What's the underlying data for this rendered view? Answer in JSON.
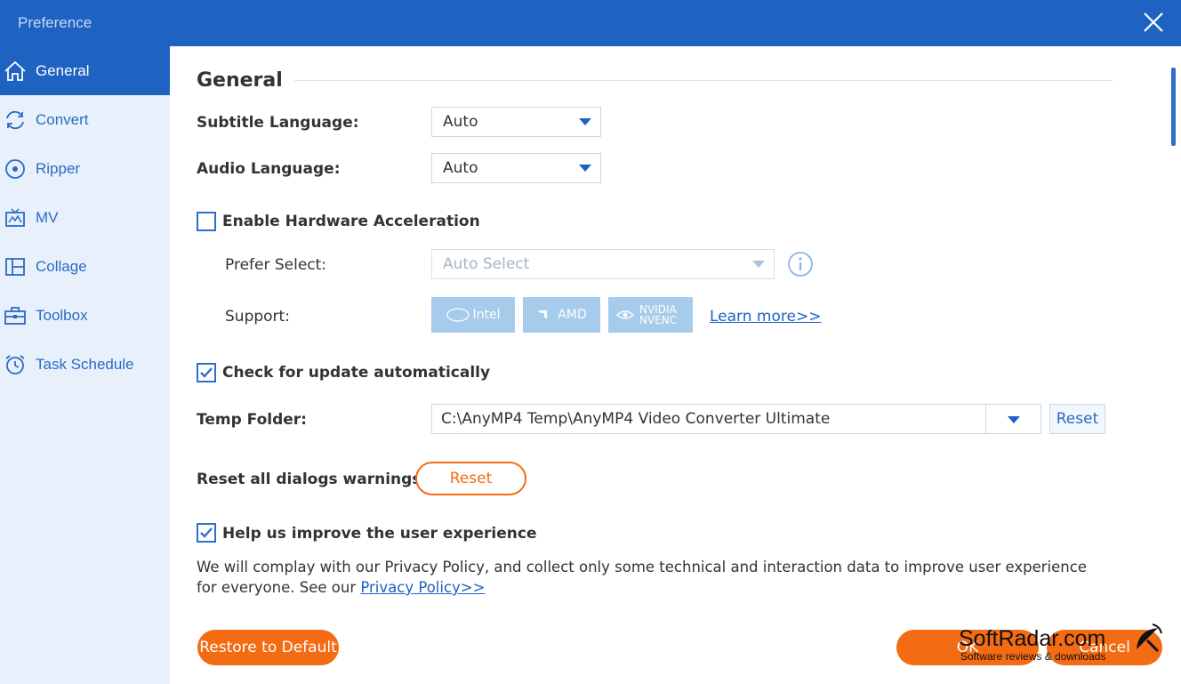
{
  "window": {
    "title": "Preference",
    "close_icon": "close-icon"
  },
  "sidebar": {
    "items": [
      {
        "label": "General",
        "icon": "home-icon",
        "active": true
      },
      {
        "label": "Convert",
        "icon": "convert-icon",
        "active": false
      },
      {
        "label": "Ripper",
        "icon": "disc-icon",
        "active": false
      },
      {
        "label": "MV",
        "icon": "tv-icon",
        "active": false
      },
      {
        "label": "Collage",
        "icon": "collage-icon",
        "active": false
      },
      {
        "label": "Toolbox",
        "icon": "toolbox-icon",
        "active": false
      },
      {
        "label": "Task Schedule",
        "icon": "alarm-clock-icon",
        "active": false
      }
    ]
  },
  "general": {
    "section_title": "General",
    "subtitle_language": {
      "label": "Subtitle Language:",
      "value": "Auto"
    },
    "audio_language": {
      "label": "Audio Language:",
      "value": "Auto"
    },
    "hardware_acceleration": {
      "label": "Enable Hardware Acceleration",
      "checked": false
    },
    "prefer_select": {
      "label": "Prefer Select:",
      "value": "Auto Select"
    },
    "support": {
      "label": "Support:",
      "badges": [
        "Intel",
        "AMD",
        "NVIDIA NVENC"
      ],
      "learn_more": "Learn more>>"
    },
    "check_update": {
      "label": "Check for update automatically",
      "checked": true
    },
    "temp_folder": {
      "label": "Temp Folder:",
      "value": "C:\\AnyMP4 Temp\\AnyMP4 Video Converter Ultimate",
      "reset_label": "Reset"
    },
    "reset_dialogs": {
      "label": "Reset all dialogs warnings:",
      "button_label": "Reset"
    },
    "improve_experience": {
      "label": "Help us improve the user experience",
      "checked": true
    },
    "privacy_text": "We will complay with our Privacy Policy, and collect only some technical and interaction data to improve user experience for everyone. See our ",
    "privacy_link": "Privacy Policy>>"
  },
  "footer": {
    "restore_label": "Restore to Default",
    "ok_label": "OK",
    "cancel_label": "Cancel"
  },
  "watermark": {
    "title": "SoftRadar.com",
    "subtitle": "Software reviews & downloads"
  },
  "colors": {
    "accent": "#1e62c2",
    "sidebar_bg": "#e8f1fb",
    "orange": "#f36b12"
  }
}
